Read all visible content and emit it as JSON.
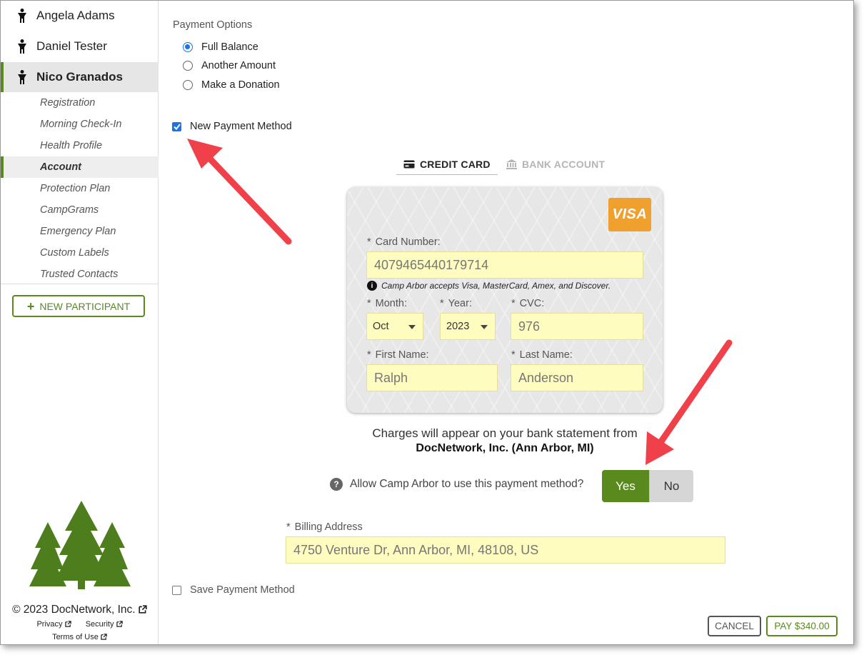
{
  "sidebar": {
    "participants": [
      {
        "name": "Angela Adams"
      },
      {
        "name": "Daniel Tester"
      },
      {
        "name": "Nico Granados"
      }
    ],
    "subnav": [
      "Registration",
      "Morning Check-In",
      "Health Profile",
      "Account",
      "Protection Plan",
      "CampGrams",
      "Emergency Plan",
      "Custom Labels",
      "Trusted Contacts"
    ],
    "active_subnav": "Account",
    "new_participant": "NEW PARTICIPANT",
    "copyright": "© 2023 DocNetwork, Inc.",
    "privacy": "Privacy",
    "security": "Security",
    "terms": "Terms of Use"
  },
  "payment": {
    "options_label": "Payment Options",
    "options": [
      "Full Balance",
      "Another Amount",
      "Make a Donation"
    ],
    "selected_option": "Full Balance",
    "new_method_label": "New Payment Method",
    "new_method_checked": true
  },
  "tabs": {
    "credit_card": "CREDIT CARD",
    "bank_account": "BANK ACCOUNT"
  },
  "card": {
    "brand": "VISA",
    "number_label": "Card Number:",
    "number_value": "4079465440179714",
    "accepts_note": "Camp Arbor accepts Visa, MasterCard, Amex, and Discover.",
    "month_label": "Month:",
    "month_value": "Oct",
    "year_label": "Year:",
    "year_value": "2023",
    "cvc_label": "CVC:",
    "cvc_value": "976",
    "first_name_label": "First Name:",
    "first_name_value": "Ralph",
    "last_name_label": "Last Name:",
    "last_name_value": "Anderson",
    "required_mark": "*"
  },
  "charges": {
    "line1": "Charges will appear on your bank statement from",
    "line2": "DocNetwork, Inc. (Ann Arbor, MI)"
  },
  "allow": {
    "question": "Allow Camp Arbor to use this payment method?",
    "yes": "Yes",
    "no": "No"
  },
  "billing": {
    "label": "Billing Address",
    "value": "4750 Venture Dr, Ann Arbor, MI, 48108, US"
  },
  "save_method_label": "Save Payment Method",
  "actions": {
    "cancel": "CANCEL",
    "pay": "PAY $340.00"
  },
  "colors": {
    "brand_green": "#5a8a1e",
    "input_yellow": "#fffcc0",
    "visa_orange": "#f0a02c",
    "annotation_red": "#f0404a",
    "checkbox_blue": "#1a73e8"
  }
}
